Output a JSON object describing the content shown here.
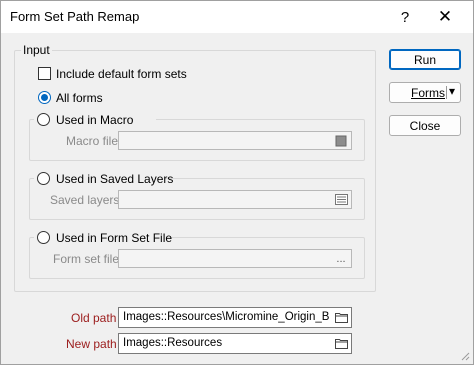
{
  "window": {
    "title": "Form Set Path Remap",
    "help_glyph": "?",
    "close_glyph": "✕"
  },
  "input_group": {
    "label": "Input",
    "include_default": {
      "label": "Include default form sets",
      "checked": false
    },
    "all_forms": {
      "label": "All forms",
      "selected": true
    },
    "macro": {
      "label": "Used in Macro",
      "field_label": "Macro file",
      "value": ""
    },
    "saved_layers": {
      "label": "Used in Saved Layers",
      "field_label": "Saved layers",
      "value": ""
    },
    "form_set_file": {
      "label": "Used in Form Set File",
      "field_label": "Form set file",
      "value": "",
      "browse_glyph": "..."
    }
  },
  "paths": {
    "old_label": "Old path",
    "old_value": "Images::Resources\\Micromine_Origin_Beyond",
    "new_label": "New path",
    "new_value": "Images::Resources"
  },
  "buttons": {
    "run": "Run",
    "forms": "Forms",
    "forms_arrow": "▾",
    "close": "Close"
  },
  "colors": {
    "accent": "#0067c0",
    "path_label": "#9b1c1c",
    "disabled_text": "#8a8a8a"
  }
}
